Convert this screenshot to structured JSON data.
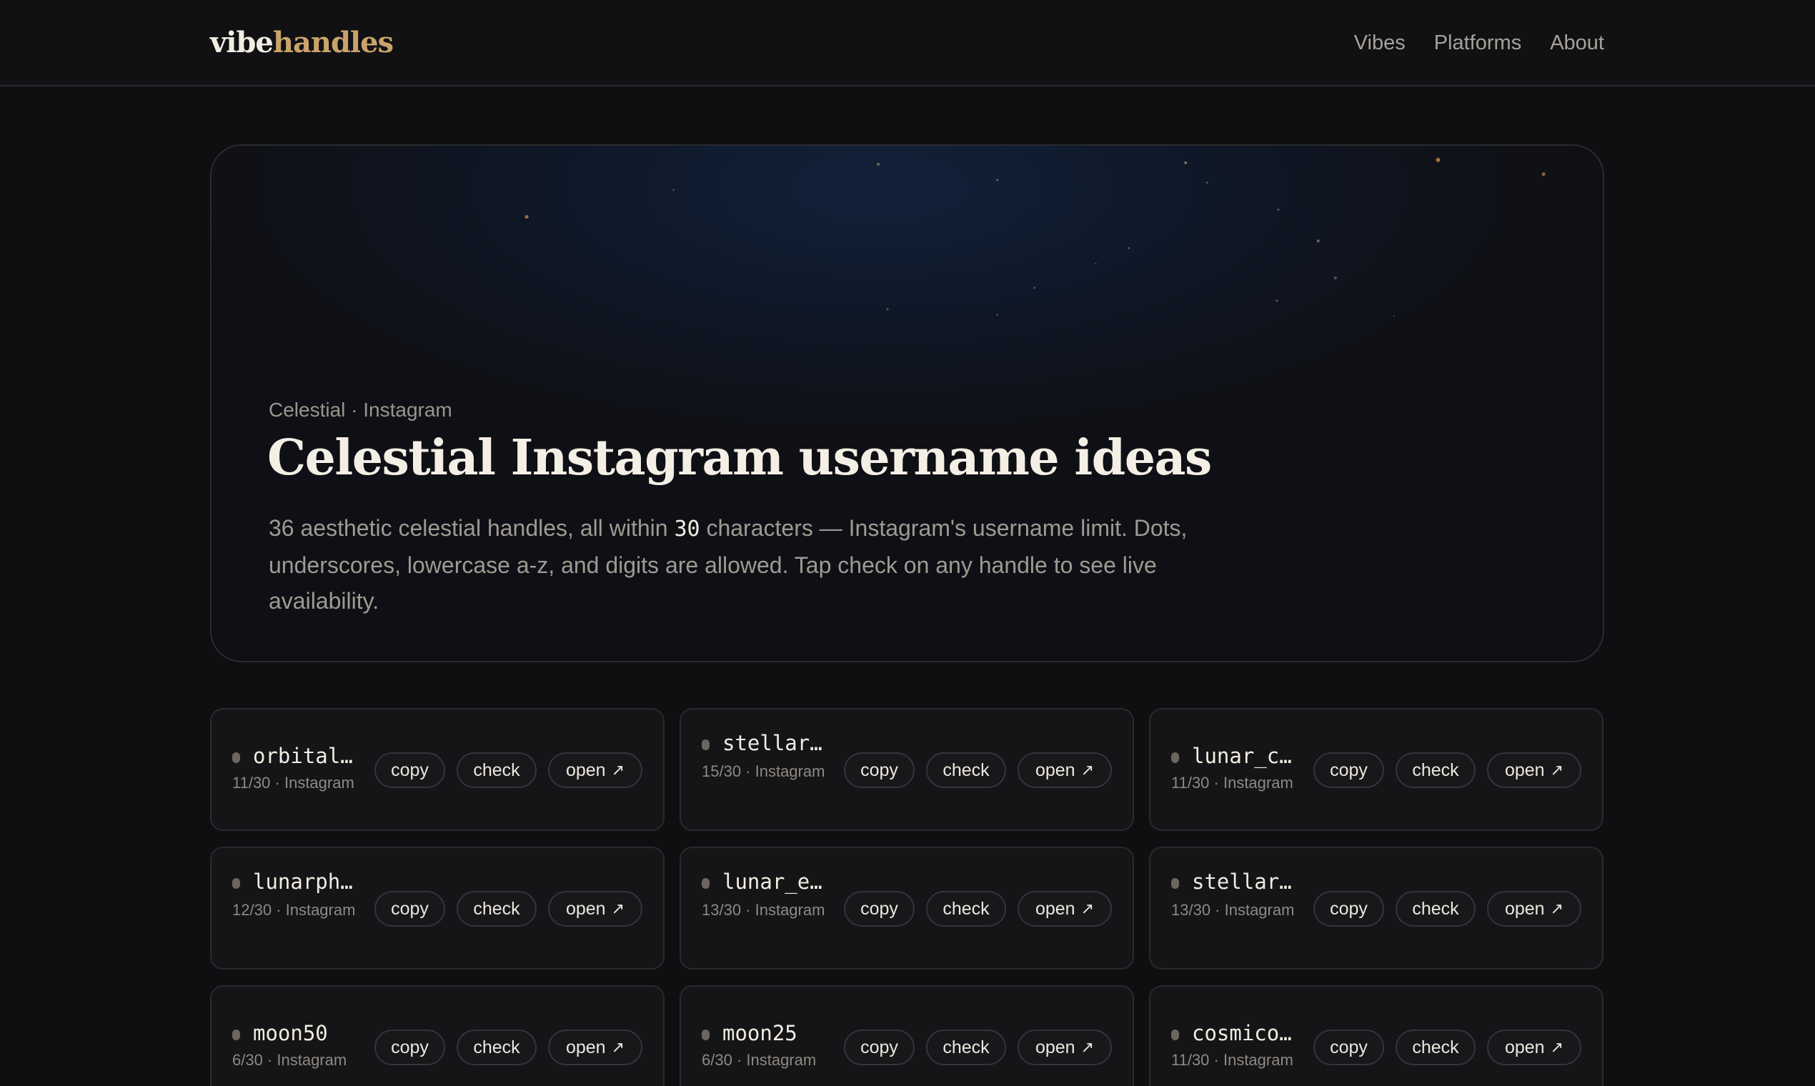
{
  "brand": {
    "part1": "vibe",
    "part2": "handles"
  },
  "nav": [
    "Vibes",
    "Platforms",
    "About"
  ],
  "hero": {
    "eyebrow": "Celestial · Instagram",
    "title": "Celestial Instagram username ideas",
    "desc_before": "36 aesthetic celestial handles, all within ",
    "desc_num": "30",
    "desc_after": " characters — Instagram's username limit. Dots, underscores, lowercase a-z, and digits are allowed. Tap check on any handle to see live availability."
  },
  "actions": {
    "copy": "copy",
    "check": "check",
    "open": "open",
    "open_icon": "↗"
  },
  "handles": [
    {
      "name": "orbital…",
      "meta": "11/30 · Instagram",
      "layout": "one"
    },
    {
      "name": "stellar…",
      "meta": "15/30 · Instagram",
      "layout": "two"
    },
    {
      "name": "lunar_c…",
      "meta": "11/30 · Instagram",
      "layout": "one"
    },
    {
      "name": "lunarph…",
      "meta": "12/30 · Instagram",
      "layout": "two"
    },
    {
      "name": "lunar_e…",
      "meta": "13/30 · Instagram",
      "layout": "two"
    },
    {
      "name": "stellar…",
      "meta": "13/30 · Instagram",
      "layout": "two"
    },
    {
      "name": "moon50",
      "meta": "6/30 · Instagram",
      "layout": "one"
    },
    {
      "name": "moon25",
      "meta": "6/30 · Instagram",
      "layout": "one"
    },
    {
      "name": "cosmico…",
      "meta": "11/30 · Instagram",
      "layout": "one"
    }
  ]
}
